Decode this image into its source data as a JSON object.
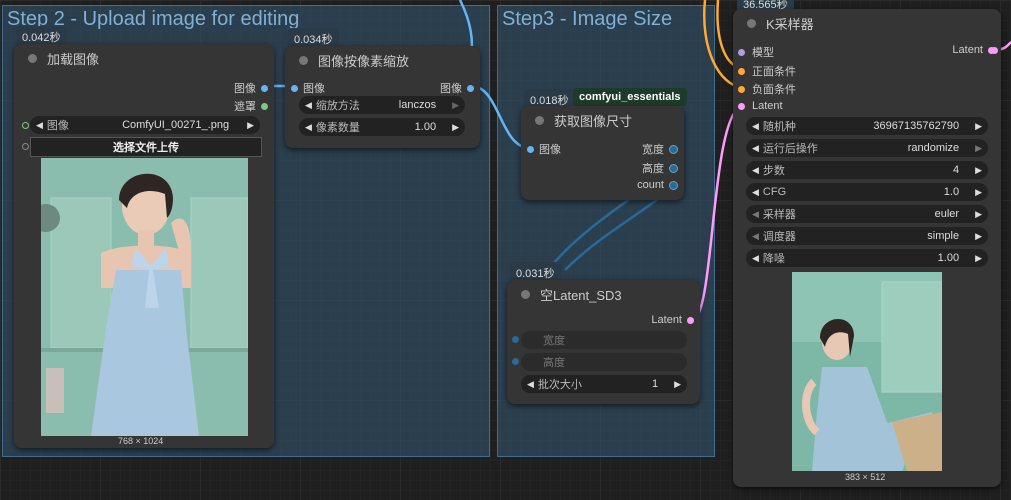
{
  "groups": {
    "step2": "Step 2 - Upload image for editing",
    "step3": "Step3 - Image Size"
  },
  "load_image": {
    "time": "0.042秒",
    "title": "加载图像",
    "out_image": "图像",
    "out_mask": "遮罩",
    "image_label": "图像",
    "image_value": "ComfyUI_00271_.png",
    "upload_button": "选择文件上传",
    "size": "768 × 1024"
  },
  "scale_image": {
    "time": "0.034秒",
    "title": "图像按像素缩放",
    "in_image": "图像",
    "out_image": "图像",
    "method_label": "缩放方法",
    "method_value": "lanczos",
    "pixels_label": "像素数量",
    "pixels_value": "1.00"
  },
  "get_size": {
    "time": "0.018秒",
    "pack": "comfyui_essentials",
    "title": "获取图像尺寸",
    "in_image": "图像",
    "out_width": "宽度",
    "out_height": "高度",
    "out_count": "count"
  },
  "empty_latent": {
    "time": "0.031秒",
    "title": "空Latent_SD3",
    "out_latent": "Latent",
    "width": "宽度",
    "height": "高度",
    "batch_label": "批次大小",
    "batch_value": "1"
  },
  "ksampler": {
    "time": "36.565秒",
    "title": "K采样器",
    "in_model": "模型",
    "in_positive": "正面条件",
    "in_negative": "负面条件",
    "in_latent": "Latent",
    "out_latent": "Latent",
    "widgets": [
      {
        "label": "随机种",
        "value": "36967135762790"
      },
      {
        "label": "运行后操作",
        "value": "randomize"
      },
      {
        "label": "步数",
        "value": "4"
      },
      {
        "label": "CFG",
        "value": "1.0"
      },
      {
        "label": "采样器",
        "value": "euler"
      },
      {
        "label": "调度器",
        "value": "simple"
      },
      {
        "label": "降噪",
        "value": "1.00"
      }
    ],
    "size": "383 × 512"
  },
  "colors": {
    "image_port": "#64b5f6",
    "mask_port": "#81c784",
    "latent_port": "#ff9cf9",
    "model_port": "#b39ddb",
    "cond_port": "#ffa931",
    "int_port": "#29699c"
  }
}
